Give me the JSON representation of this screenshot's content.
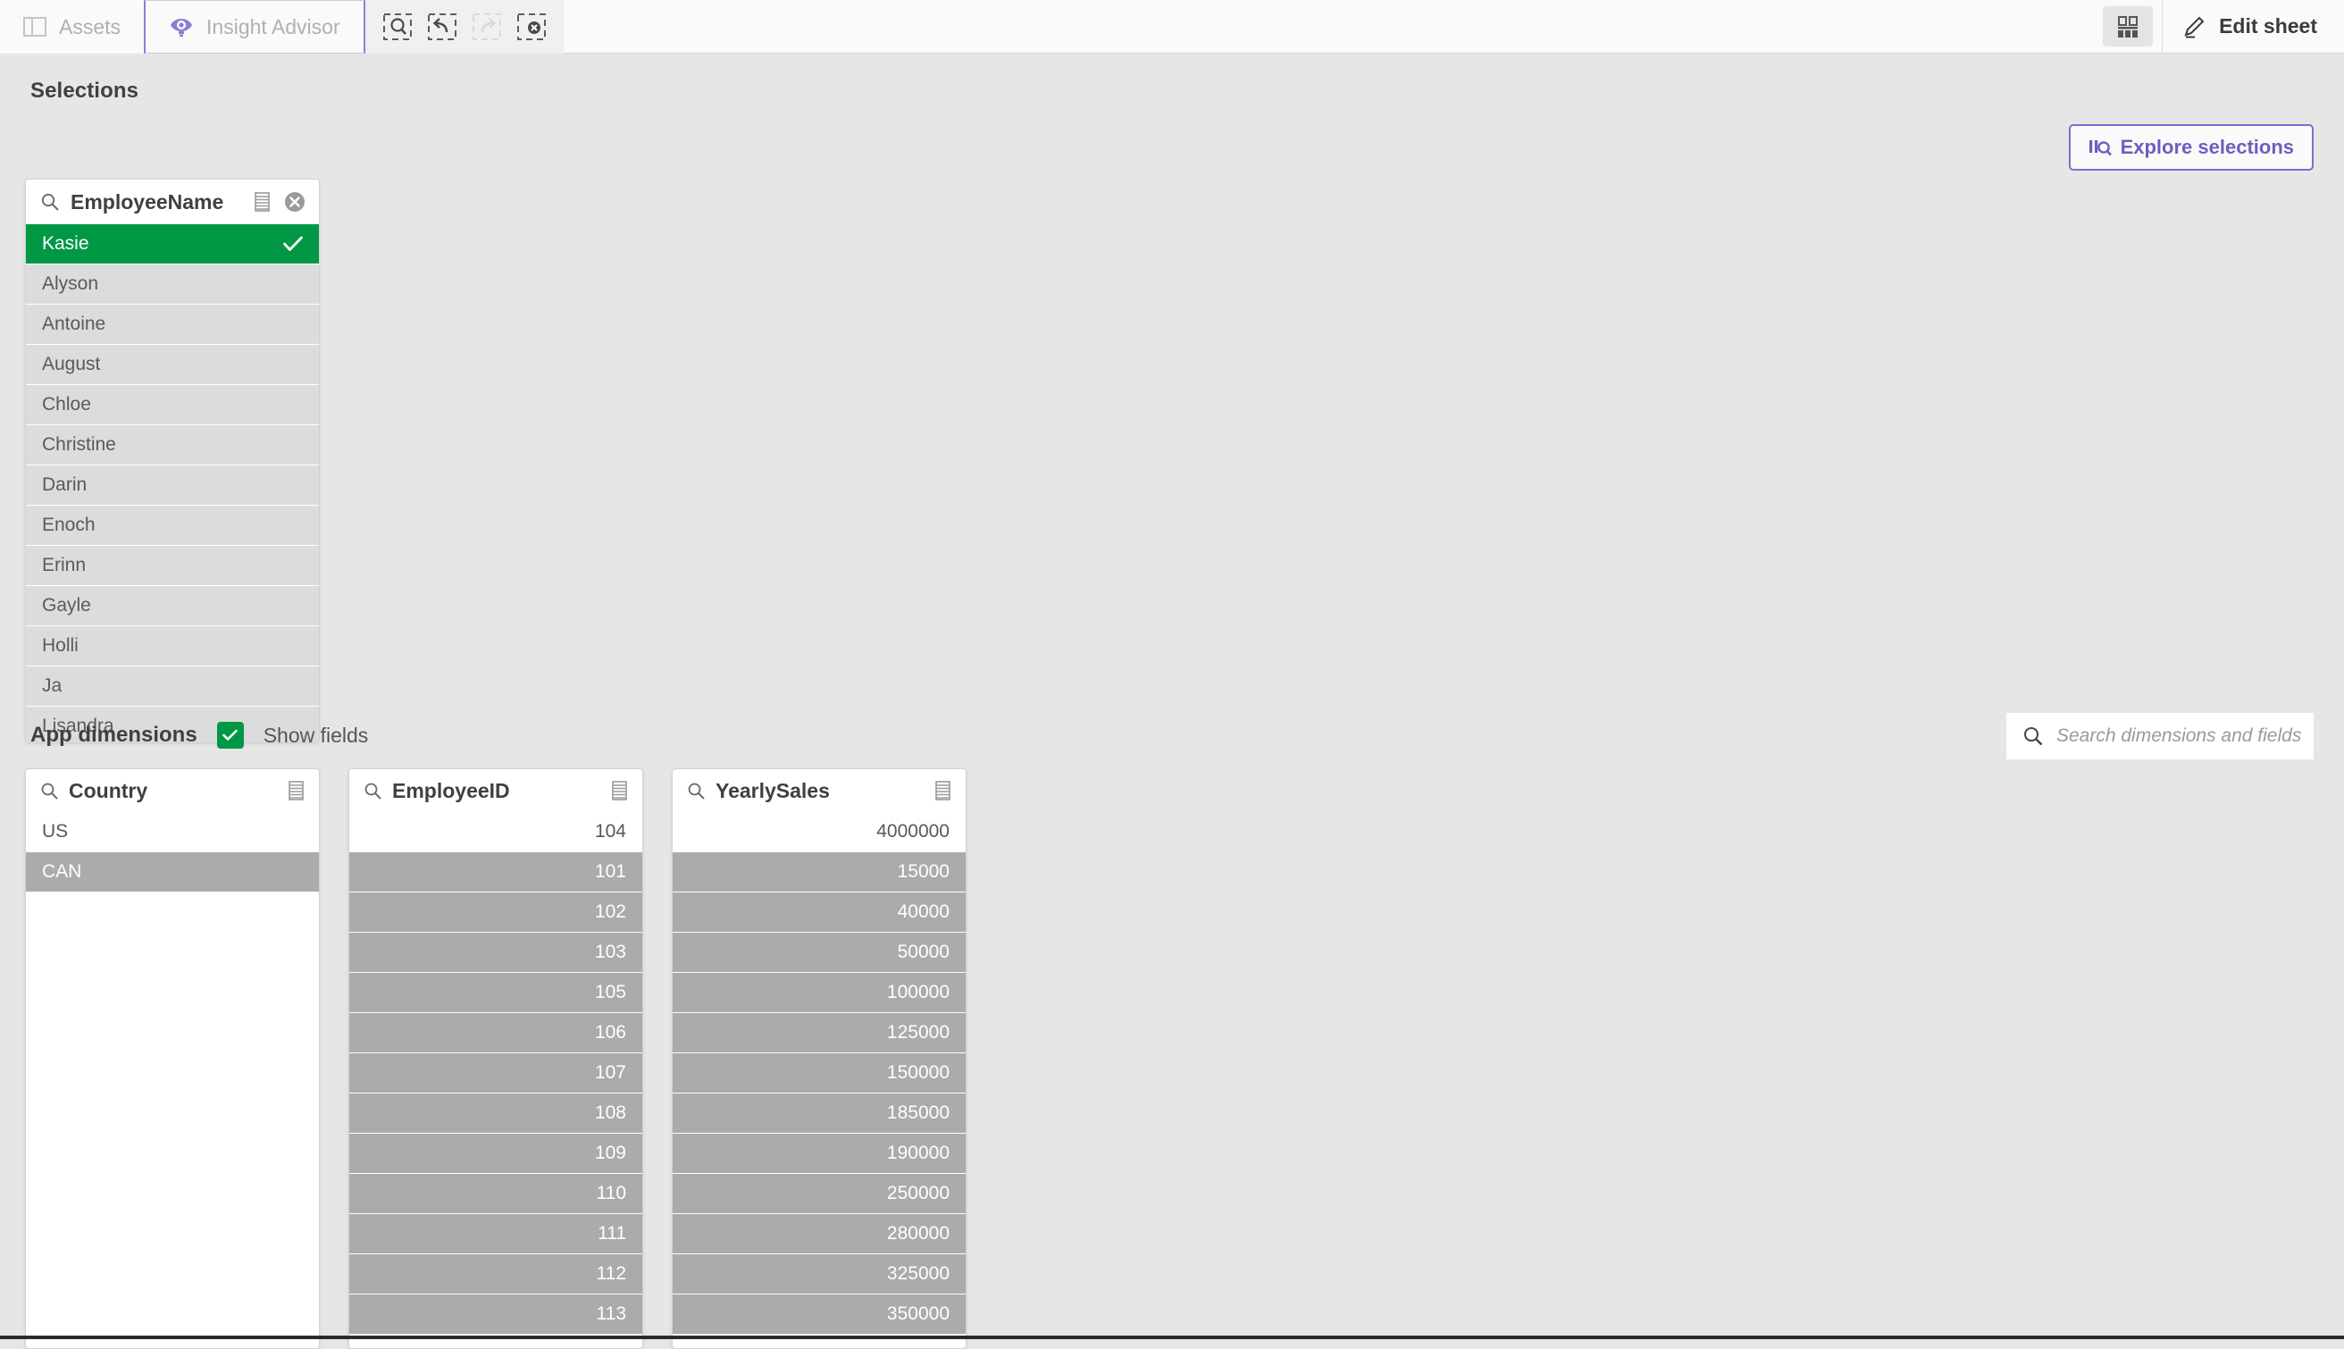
{
  "topbar": {
    "tabs": [
      {
        "label": "Assets",
        "icon": "panel-icon",
        "active": false
      },
      {
        "label": "Insight Advisor",
        "icon": "insight-bulb-icon",
        "active": true
      }
    ],
    "selection_tools": [
      {
        "name": "selection-search-tool",
        "disabled": false
      },
      {
        "name": "step-back-tool",
        "disabled": false
      },
      {
        "name": "step-forward-tool",
        "disabled": true
      },
      {
        "name": "clear-all-selections-tool",
        "disabled": false
      }
    ],
    "sheet_view_icon": "sheet-grid-icon",
    "edit_label": "Edit sheet",
    "edit_icon": "pencil-icon"
  },
  "selections": {
    "title": "Selections",
    "explore_label": "Explore selections",
    "explore_icon": "explore-selections-icon",
    "card": {
      "field": "EmployeeName",
      "search_icon": "search-icon",
      "list_icon": "list-view-icon",
      "clear_icon": "clear-circle-icon",
      "values": [
        {
          "label": "Kasie",
          "state": "selected"
        },
        {
          "label": "Alyson",
          "state": "optional"
        },
        {
          "label": "Antoine",
          "state": "optional"
        },
        {
          "label": "August",
          "state": "optional"
        },
        {
          "label": "Chloe",
          "state": "optional"
        },
        {
          "label": "Christine",
          "state": "optional"
        },
        {
          "label": "Darin",
          "state": "optional"
        },
        {
          "label": "Enoch",
          "state": "optional"
        },
        {
          "label": "Erinn",
          "state": "optional"
        },
        {
          "label": "Gayle",
          "state": "optional"
        },
        {
          "label": "Holli",
          "state": "optional"
        },
        {
          "label": "Ja",
          "state": "optional"
        },
        {
          "label": "Lisandra",
          "state": "optional"
        }
      ]
    }
  },
  "app_dimensions": {
    "title": "App dimensions",
    "show_fields_label": "Show fields",
    "show_fields_checked": true,
    "search_placeholder": "Search dimensions and fields",
    "search_value": "",
    "search_icon": "search-icon",
    "cards": [
      {
        "field": "Country",
        "align": "left",
        "values": [
          {
            "label": "US",
            "state": "plain"
          },
          {
            "label": "CAN",
            "state": "excluded"
          }
        ]
      },
      {
        "field": "EmployeeID",
        "align": "right",
        "values": [
          {
            "label": "104",
            "state": "plain"
          },
          {
            "label": "101",
            "state": "excluded"
          },
          {
            "label": "102",
            "state": "excluded"
          },
          {
            "label": "103",
            "state": "excluded"
          },
          {
            "label": "105",
            "state": "excluded"
          },
          {
            "label": "106",
            "state": "excluded"
          },
          {
            "label": "107",
            "state": "excluded"
          },
          {
            "label": "108",
            "state": "excluded"
          },
          {
            "label": "109",
            "state": "excluded"
          },
          {
            "label": "110",
            "state": "excluded"
          },
          {
            "label": "111",
            "state": "excluded"
          },
          {
            "label": "112",
            "state": "excluded"
          },
          {
            "label": "113",
            "state": "excluded"
          }
        ]
      },
      {
        "field": "YearlySales",
        "align": "right",
        "values": [
          {
            "label": "4000000",
            "state": "plain"
          },
          {
            "label": "15000",
            "state": "excluded"
          },
          {
            "label": "40000",
            "state": "excluded"
          },
          {
            "label": "50000",
            "state": "excluded"
          },
          {
            "label": "100000",
            "state": "excluded"
          },
          {
            "label": "125000",
            "state": "excluded"
          },
          {
            "label": "150000",
            "state": "excluded"
          },
          {
            "label": "185000",
            "state": "excluded"
          },
          {
            "label": "190000",
            "state": "excluded"
          },
          {
            "label": "250000",
            "state": "excluded"
          },
          {
            "label": "280000",
            "state": "excluded"
          },
          {
            "label": "325000",
            "state": "excluded"
          },
          {
            "label": "350000",
            "state": "excluded"
          }
        ]
      }
    ]
  },
  "colors": {
    "selected_green": "#009845",
    "excluded_grey": "#ababab",
    "optional_grey": "#dcdcdc",
    "accent_purple": "#7b6fce",
    "page_bg": "#e6e6e6"
  }
}
